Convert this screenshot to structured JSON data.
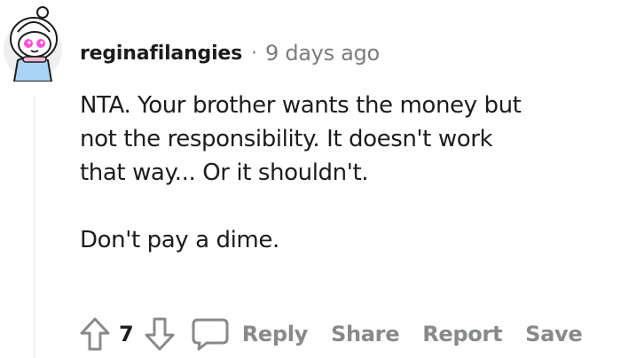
{
  "comment": {
    "username": "reginafilangies",
    "separator": "·",
    "timestamp": "9 days ago",
    "paragraphs": [
      "NTA. Your brother wants the money but",
      "not the responsibility. It doesn't work",
      "that way... Or it shouldn't."
    ],
    "second_paragraph": "Don't pay a dime.",
    "score": "7",
    "actions": {
      "reply": "Reply",
      "share": "Share",
      "report": "Report",
      "save": "Save"
    },
    "icons": {
      "avatar": "snoo-avatar-with-hood",
      "upvote": "upvote-arrow-icon",
      "downvote": "downvote-arrow-icon",
      "reply": "speech-bubble-icon"
    },
    "colors": {
      "text": "#1c1c1c",
      "meta": "#7c7c7c",
      "action": "#878a8c",
      "thread_line": "#edeff1",
      "avatar_eye": "#ff4fd8",
      "avatar_coat": "#a9d4f5"
    }
  }
}
